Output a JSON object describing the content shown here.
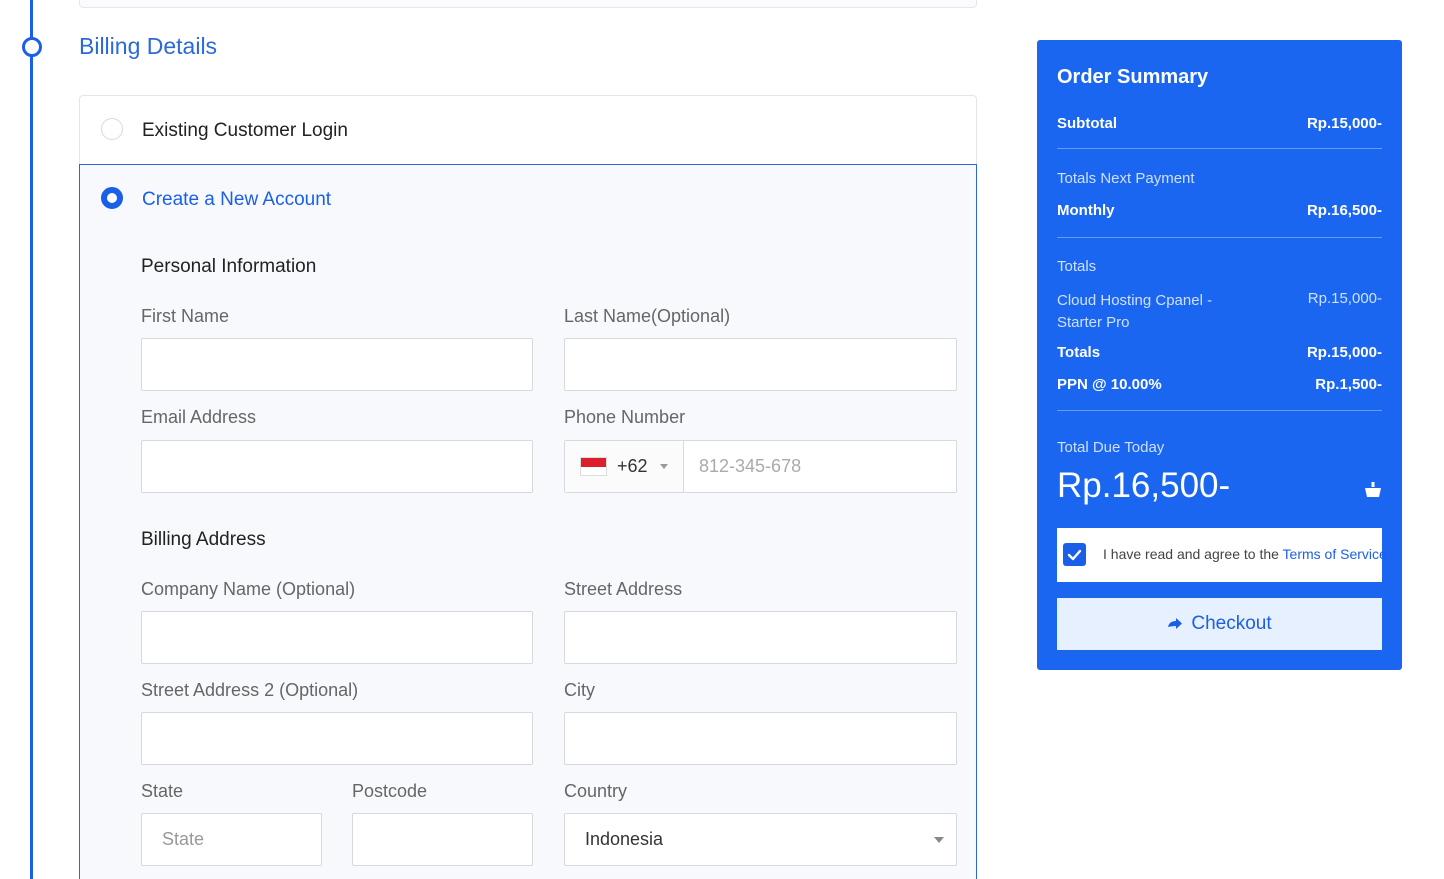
{
  "billing": {
    "section_title": "Billing Details",
    "options": {
      "login_label": "Existing Customer Login",
      "create_label": "Create a New Account"
    },
    "personal": {
      "heading": "Personal Information",
      "first_name_label": "First Name",
      "last_name_label": "Last Name(Optional)",
      "email_label": "Email Address",
      "phone_label": "Phone Number",
      "phone_prefix": "+62",
      "phone_placeholder": "812-345-678"
    },
    "address": {
      "heading": "Billing Address",
      "company_label": "Company Name (Optional)",
      "street_label": "Street Address",
      "street2_label": "Street Address 2 (Optional)",
      "city_label": "City",
      "state_label": "State",
      "state_placeholder": "State",
      "postcode_label": "Postcode",
      "country_label": "Country",
      "country_value": "Indonesia"
    }
  },
  "summary": {
    "title": "Order Summary",
    "subtotal_label": "Subtotal",
    "subtotal_value": "Rp.15,000-",
    "next_payment_label": "Totals Next Payment",
    "monthly_label": "Monthly",
    "monthly_value": "Rp.16,500-",
    "totals_header": "Totals",
    "product_line1": "Cloud Hosting Cpanel -",
    "product_line2": "Starter Pro",
    "product_value": "Rp.15,000-",
    "totals_label": "Totals",
    "totals_value": "Rp.15,000-",
    "tax_label": "PPN @ 10.00%",
    "tax_value": "Rp.1,500-",
    "due_label": "Total Due Today",
    "due_value": "Rp.16,500-",
    "tos_text": "I have read and agree to the ",
    "tos_link": "Terms of Service",
    "checkout_label": "Checkout"
  },
  "colors": {
    "accent": "#1a5fe8",
    "summary_bg": "#1a66f0",
    "flag_red": "#d9202b"
  },
  "icons": {
    "timeline_marker": "circle-step-icon",
    "cart": "cart-icon",
    "checkout": "arrow-right-icon",
    "checkbox": "check-icon",
    "flag": "flag-indonesia-icon"
  }
}
